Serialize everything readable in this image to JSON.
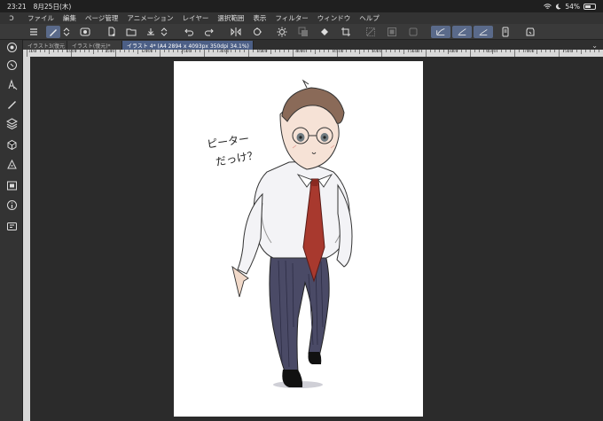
{
  "status": {
    "time": "23:21",
    "date": "8月25日(木)",
    "battery": "54%",
    "battery_level": 0.54
  },
  "menu": {
    "items": [
      "ファイル",
      "編集",
      "ページ管理",
      "アニメーション",
      "レイヤー",
      "選択範囲",
      "表示",
      "フィルター",
      "ウィンドウ",
      "ヘルプ"
    ]
  },
  "tabs": [
    {
      "label": "イラスト3(復元"
    },
    {
      "label": "イラスト(復元)*"
    },
    {
      "label": "イラスト 4* (A4 2894 x 4093px 350dpi 34.1%)"
    }
  ],
  "ruler": {
    "labels": [
      "100",
      "1000",
      "1500",
      "2000",
      "2500",
      "3000",
      "3500",
      "4000",
      "4500",
      "5000",
      "5500",
      "6000",
      "6500",
      "7000",
      "7500"
    ]
  },
  "canvas": {
    "handwriting_line1": "ピーター",
    "handwriting_line2": "だっけ？"
  },
  "colors": {
    "accent": "#5a6a8a",
    "active_tab": "#4c5f86",
    "tie": "#a8392e",
    "trousers": "#4a4a66"
  }
}
